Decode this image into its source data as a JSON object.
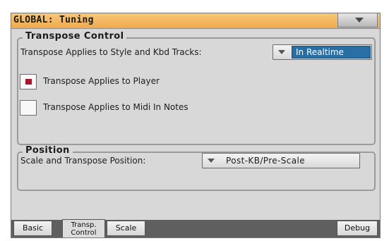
{
  "window": {
    "title": "GLOBAL: Tuning"
  },
  "transpose_group": {
    "legend": "Transpose Control",
    "applies_label": "Transpose Applies to Style and Kbd Tracks:",
    "applies_value": "In Realtime",
    "player_label": "Transpose Applies to Player",
    "player_checked": true,
    "midi_label": "Transpose Applies to Midi In Notes",
    "midi_checked": false
  },
  "position_group": {
    "legend": "Position",
    "scale_label": "Scale and Transpose Position:",
    "scale_value": "Post-KB/Pre-Scale"
  },
  "tabs": [
    {
      "label": "Basic",
      "active": false
    },
    {
      "label": "Transp.\nControl",
      "active": true
    },
    {
      "label": "Scale",
      "active": false
    },
    {
      "label": "Debug",
      "active": false
    }
  ],
  "colors": {
    "title_bar": "#f0a94e",
    "selected_value": "#2a6fa3",
    "checkbox_mark": "#a31b2a"
  }
}
